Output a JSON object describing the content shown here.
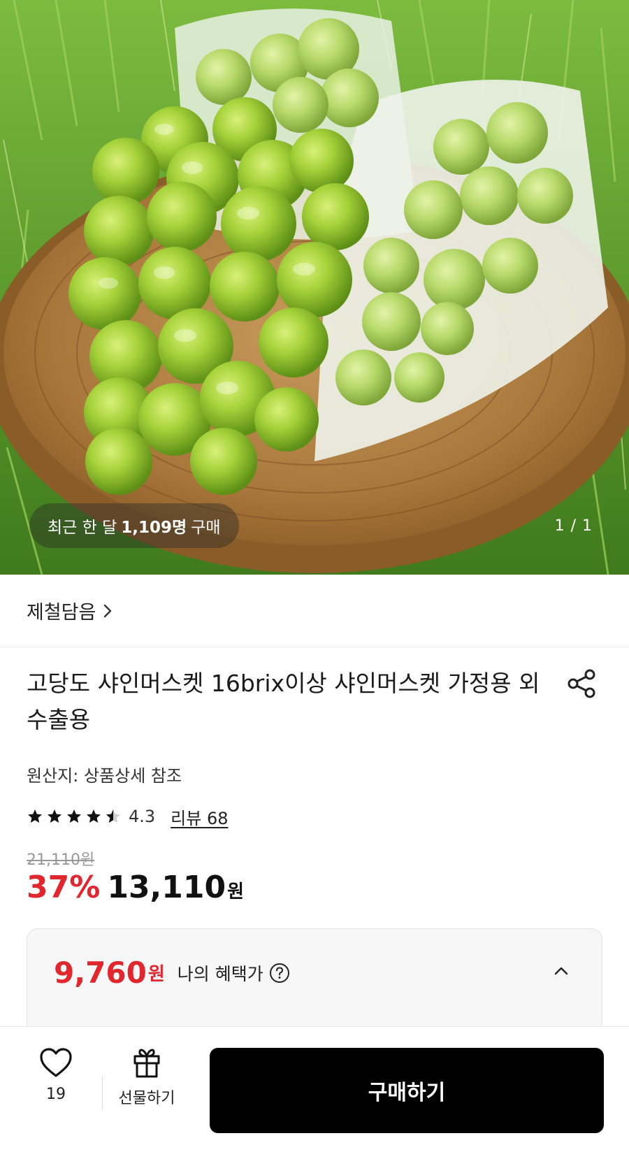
{
  "hero": {
    "image_alt": "",
    "buyers_prefix": "최근 한 달",
    "buyers_count": "1,109명",
    "buyers_suffix": "구매",
    "image_counter": "1 / 1"
  },
  "seller": {
    "name": "제철담음"
  },
  "product": {
    "title": "고당도 샤인머스켓 16brix이상 샤인머스켓 가정용 외 수출용",
    "origin": "원산지: 상품상세 참조",
    "rating": 4.3,
    "rating_text": "4.3",
    "review_text": "리뷰 68",
    "original_price": "21,110원",
    "discount": "37%",
    "price": "13,110",
    "price_unit": "원"
  },
  "benefit": {
    "price": "9,760",
    "unit": "원",
    "label": "나의 혜택가"
  },
  "bottom_bar": {
    "like_count": "19",
    "gift_label": "선물하기",
    "buy_label": "구매하기"
  },
  "colors": {
    "accent_red": "#e1262d",
    "buy_button": "#000000",
    "star": "#111111"
  },
  "icons": [
    "chevron-right-icon",
    "share-icon",
    "star-icon",
    "help-icon",
    "chevron-up-icon",
    "heart-icon",
    "gift-icon"
  ]
}
